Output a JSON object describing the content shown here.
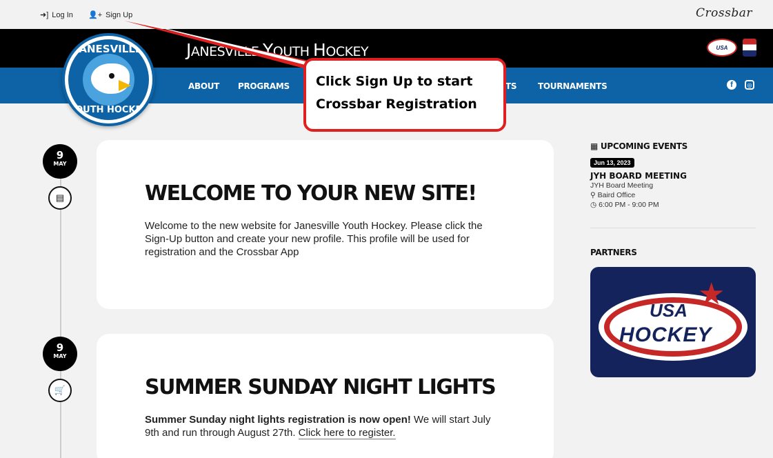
{
  "topbar": {
    "login_label": "Log In",
    "signup_label": "Sign Up",
    "crossbar_brand": "Crossbar"
  },
  "header": {
    "title_prefix": "J",
    "title_rest": "ANESVILLE ",
    "title_y": "Y",
    "title_outh": "OUTH ",
    "title_h": "H",
    "title_ockey": "OCKEY"
  },
  "logo": {
    "top_text": "JANESVILLE",
    "bottom_text": "YOUTH HOCKEY"
  },
  "nav": {
    "items": [
      "ABOUT",
      "PROGRAMS",
      "TS",
      "TOURNAMENTS"
    ]
  },
  "callout": {
    "line1": "Click Sign Up to start",
    "line2": "Crossbar Registration"
  },
  "posts": [
    {
      "day": "9",
      "month": "MAY",
      "icon": "newspaper-icon",
      "title": "WELCOME TO YOUR NEW SITE!",
      "body": "Welcome to the new website for Janesville Youth Hockey.  Please click the Sign-Up button and create your new profile.  This profile will be used for registration and the Crossbar App"
    },
    {
      "day": "9",
      "month": "MAY",
      "icon": "cart-icon",
      "title": "SUMMER SUNDAY NIGHT LIGHTS",
      "body_bold": "Summer Sunday night lights registration is now open!",
      "body_rest": " We will start July 9th and run through August 27th. ",
      "link_text": "Click here to register."
    }
  ],
  "sidebar": {
    "events_heading": "UPCOMING EVENTS",
    "event": {
      "date": "Jun 13, 2023",
      "title": "JYH BOARD MEETING",
      "subtitle": "JYH Board Meeting",
      "location": "Baird Office",
      "time": "6:00 PM - 9:00 PM"
    },
    "partners_heading": "PARTNERS",
    "partner_text_1": "USA",
    "partner_text_2": "HOCKEY"
  },
  "colors": {
    "nav_blue": "#0d63a6",
    "callout_red": "#e02020",
    "header_black": "#000000"
  }
}
